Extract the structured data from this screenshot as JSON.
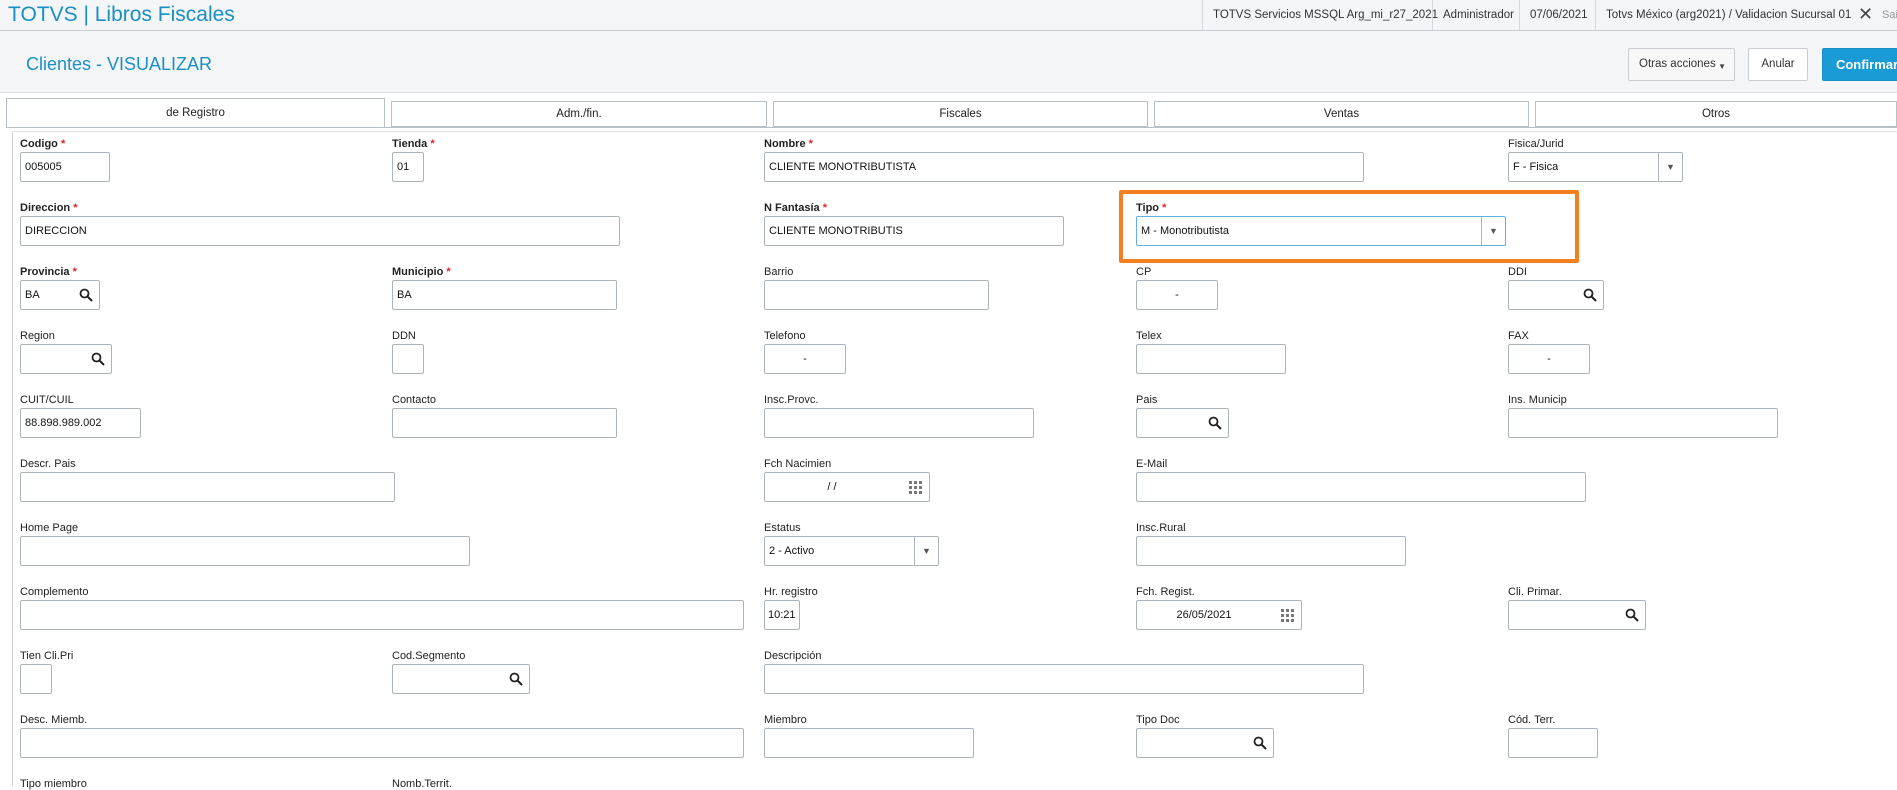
{
  "app": {
    "title": "TOTVS | Libros Fiscales"
  },
  "topbar": {
    "server": "TOTVS Servicios MSSQL Arg_mi_r27_2021",
    "user": "Administrador",
    "date": "07/06/2021",
    "company": "Totvs México (arg2021) / Validacion Sucursal 01",
    "close": "✕",
    "exit": "Sai"
  },
  "header": {
    "title": "Clientes - VISUALIZAR",
    "otras": "Otras acciones",
    "anular": "Anular",
    "confirmar": "Confirmar"
  },
  "tabs": [
    "de Registro",
    "Adm./fin.",
    "Fiscales",
    "Ventas",
    "Otros"
  ],
  "form": {
    "codigo": {
      "label": "Codigo",
      "value": "005005"
    },
    "tienda": {
      "label": "Tienda",
      "value": "01"
    },
    "nombre": {
      "label": "Nombre",
      "value": "CLIENTE MONOTRIBUTISTA"
    },
    "fisica": {
      "label": "Fisica/Jurid",
      "value": "F - Fisica"
    },
    "direccion": {
      "label": "Direccion",
      "value": "DIRECCION"
    },
    "fantasia": {
      "label": "N Fantasía",
      "value": "CLIENTE MONOTRIBUTIS"
    },
    "tipo": {
      "label": "Tipo",
      "value": "M - Monotributista"
    },
    "provincia": {
      "label": "Provincia",
      "value": "BA"
    },
    "municipio": {
      "label": "Municipio",
      "value": "BA"
    },
    "barrio": {
      "label": "Barrio",
      "value": ""
    },
    "cp": {
      "label": "CP",
      "value": "-"
    },
    "ddi": {
      "label": "DDI",
      "value": ""
    },
    "region": {
      "label": "Region",
      "value": ""
    },
    "ddn": {
      "label": "DDN",
      "value": ""
    },
    "telefono": {
      "label": "Telefono",
      "value": "-"
    },
    "telex": {
      "label": "Telex",
      "value": ""
    },
    "fax": {
      "label": "FAX",
      "value": "-"
    },
    "cuit": {
      "label": "CUIT/CUIL",
      "value": "88.898.989.002"
    },
    "contacto": {
      "label": "Contacto",
      "value": ""
    },
    "insc_provc": {
      "label": "Insc.Provc.",
      "value": ""
    },
    "pais": {
      "label": "Pais",
      "value": ""
    },
    "ins_municip": {
      "label": "Ins. Municip",
      "value": ""
    },
    "descr_pais": {
      "label": "Descr. Pais",
      "value": ""
    },
    "fch_nacimien": {
      "label": "Fch Nacimien",
      "value": "/ /"
    },
    "email": {
      "label": "E-Mail",
      "value": ""
    },
    "home_page": {
      "label": "Home Page",
      "value": ""
    },
    "estatus": {
      "label": "Estatus",
      "value": "2 - Activo"
    },
    "insc_rural": {
      "label": "Insc.Rural",
      "value": ""
    },
    "complemento": {
      "label": "Complemento",
      "value": ""
    },
    "hr_registro": {
      "label": "Hr. registro",
      "value": "10:21"
    },
    "fch_regist": {
      "label": "Fch. Regist.",
      "value": "26/05/2021"
    },
    "cli_primar": {
      "label": "Cli. Primar.",
      "value": ""
    },
    "tien_cli_pri": {
      "label": "Tien Cli.Pri",
      "value": ""
    },
    "cod_segmento": {
      "label": "Cod.Segmento",
      "value": ""
    },
    "descripcion": {
      "label": "Descripción",
      "value": ""
    },
    "desc_miemb": {
      "label": "Desc. Miemb.",
      "value": ""
    },
    "miembro": {
      "label": "Miembro",
      "value": ""
    },
    "tipo_doc": {
      "label": "Tipo Doc",
      "value": ""
    },
    "cod_terr": {
      "label": "Cód. Terr.",
      "value": ""
    },
    "tipo_miembro": {
      "label": "Tipo miembro",
      "value": ""
    },
    "nomb_territ": {
      "label": "Nomb.Territ.",
      "value": ""
    }
  }
}
